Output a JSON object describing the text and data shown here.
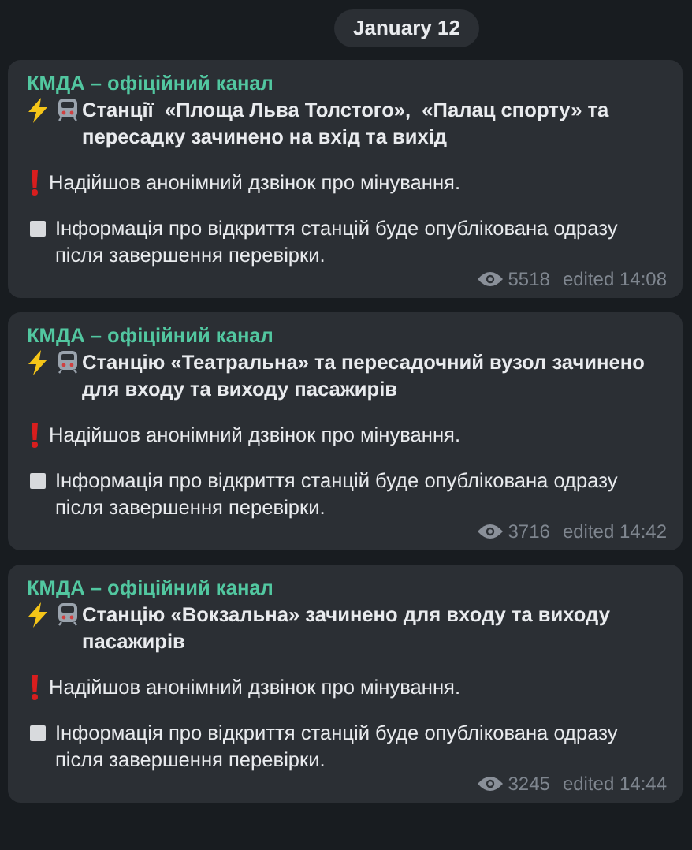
{
  "date": "January 12",
  "messages": [
    {
      "channel": "КМДА – офіційний канал",
      "headline": "Станції  «Площа Льва Толстого»,  «Палац спорту» та пересадку зачинено на вхід та вихід",
      "alert": "Надійшов анонімний дзвінок про мінування.",
      "info": "Інформація про відкриття станцій буде опублікована одразу після завершення перевірки.",
      "views": "5518",
      "edited": "edited 14:08"
    },
    {
      "channel": "КМДА – офіційний канал",
      "headline": "Станцію «Театральна» та пересадочний вузол зачинено для входу та виходу пасажирів",
      "alert": "Надійшов анонімний дзвінок про мінування.",
      "info": "Інформація про відкриття станцій буде опублікована одразу після завершення перевірки.",
      "views": "3716",
      "edited": "edited 14:42"
    },
    {
      "channel": "КМДА – офіційний канал",
      "headline": "Станцію «Вокзальна» зачинено для входу та виходу пасажирів",
      "alert": "Надійшов анонімний дзвінок про мінування.",
      "info": "Інформація про відкриття станцій буде опублікована одразу після завершення перевірки.",
      "views": "3245",
      "edited": "edited 14:44"
    }
  ]
}
